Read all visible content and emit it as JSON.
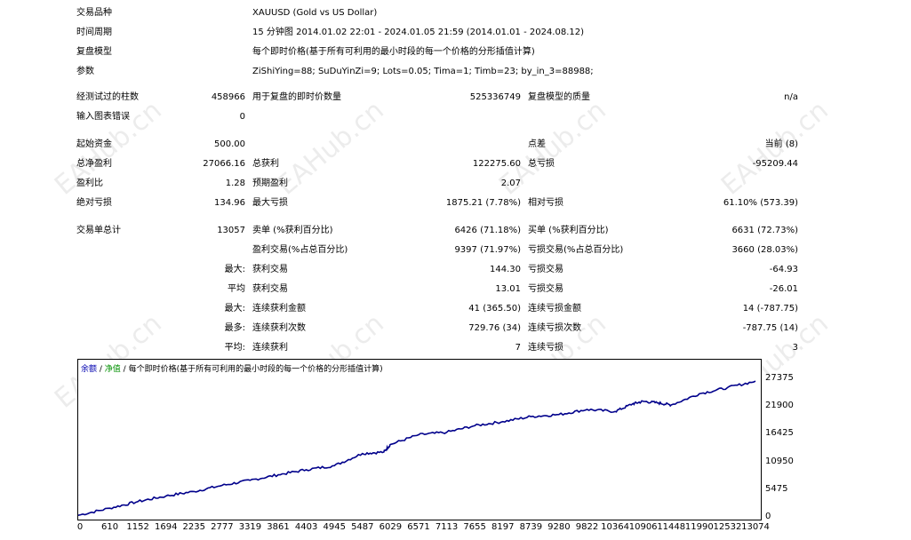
{
  "watermark": "EAHub.cn",
  "settings": {
    "symbol_label": "交易品种",
    "symbol_value": "XAUUSD (Gold vs US Dollar)",
    "period_label": "时间周期",
    "period_value": "15 分钟图 2014.01.02 22:01 - 2024.01.05 21:59 (2014.01.01 - 2024.08.12)",
    "model_label": "复盘模型",
    "model_value": "每个即时价格(基于所有可利用的最小时段的每一个价格的分形插值计算)",
    "params_label": "参数",
    "params_value": "ZiShiYing=88; SuDuYinZi=9; Lots=0.05; Tima=1; Timb=23; by_in_3=88988;"
  },
  "stats": {
    "bars_label": "经测试过的柱数",
    "bars_value": "458966",
    "ticks_label": "用于复盘的即时价数量",
    "ticks_value": "525336749",
    "quality_label": "复盘模型的质量",
    "quality_value": "n/a",
    "mismatch_label": "输入图表错误",
    "mismatch_value": "0",
    "deposit_label": "起始资金",
    "deposit_value": "500.00",
    "spread_label": "点差",
    "spread_value": "当前 (8)",
    "netprofit_label": "总净盈利",
    "netprofit_value": "27066.16",
    "grossprofit_label": "总获利",
    "grossprofit_value": "122275.60",
    "grossloss_label": "总亏损",
    "grossloss_value": "-95209.44",
    "pf_label": "盈利比",
    "pf_value": "1.28",
    "payoff_label": "预期盈利",
    "payoff_value": "2.07",
    "absdd_label": "绝对亏损",
    "absdd_value": "134.96",
    "maxdd_label": "最大亏损",
    "maxdd_value": "1875.21 (7.78%)",
    "reldd_label": "相对亏损",
    "reldd_value": "61.10% (573.39)",
    "trades_label": "交易单总计",
    "trades_value": "13057",
    "short_label": "卖单 (%获利百分比)",
    "short_value": "6426 (71.18%)",
    "long_label": "买单 (%获利百分比)",
    "long_value": "6631 (72.73%)",
    "profittrades_label": "盈利交易(%占总百分比)",
    "profittrades_value": "9397 (71.97%)",
    "losstrades_label": "亏损交易(%占总百分比)",
    "losstrades_value": "3660 (28.03%)",
    "largest_label": "最大:",
    "largest_profit_label": "获利交易",
    "largest_profit_value": "144.30",
    "largest_loss_label": "亏损交易",
    "largest_loss_value": "-64.93",
    "average_label": "平均",
    "average_profit_label": "获利交易",
    "average_profit_value": "13.01",
    "average_loss_label": "亏损交易",
    "average_loss_value": "-26.01",
    "maxcons_label": "最大:",
    "maxcons_wins_label": "连续获利金额",
    "maxcons_wins_value": "41 (365.50)",
    "maxcons_losses_label": "连续亏损金额",
    "maxcons_losses_value": "14 (-787.75)",
    "maxconsp_label": "最多:",
    "maxconsp_profit_label": "连续获利次数",
    "maxconsp_profit_value": "729.76 (34)",
    "maxconsp_loss_label": "连续亏损次数",
    "maxconsp_loss_value": "-787.75 (14)",
    "avgcons_label": "平均:",
    "avgcons_wins_label": "连续获利",
    "avgcons_wins_value": "7",
    "avgcons_losses_label": "连续亏损",
    "avgcons_losses_value": "3"
  },
  "chart_header": {
    "balance": "余额",
    "sep1": " / ",
    "equity": "净值",
    "sep2": " / ",
    "model": "每个即时价格(基于所有可利用的最小时段的每一个价格的分形插值计算)"
  },
  "chart_data": {
    "type": "line",
    "ylim": [
      0,
      27375
    ],
    "xlim": [
      0,
      13074
    ],
    "y_ticks": [
      "27375",
      "21900",
      "16425",
      "10950",
      "5475",
      "0"
    ],
    "x_ticks": [
      "0",
      "610",
      "1152",
      "1694",
      "2235",
      "2777",
      "3319",
      "3861",
      "4403",
      "4945",
      "5487",
      "6029",
      "6571",
      "7113",
      "7655",
      "8197",
      "8739",
      "9280",
      "9822",
      "10364",
      "10906",
      "11448",
      "11990",
      "12532",
      "13074"
    ],
    "series": [
      {
        "color": "#00008b",
        "x": [
          0,
          610,
          1152,
          1694,
          2235,
          2777,
          3319,
          3861,
          4403,
          4945,
          5487,
          5900,
          6029,
          6571,
          7113,
          7655,
          8197,
          8739,
          9280,
          9822,
          10364,
          10700,
          10906,
          11200,
          11448,
          11990,
          12532,
          13074
        ],
        "y": [
          500,
          1900,
          3200,
          4300,
          5200,
          6400,
          7400,
          8500,
          9500,
          10300,
          12700,
          13000,
          14500,
          16400,
          16900,
          18200,
          19000,
          20000,
          20400,
          21400,
          21000,
          22500,
          23000,
          22700,
          22300,
          24500,
          25700,
          27000
        ]
      }
    ]
  }
}
